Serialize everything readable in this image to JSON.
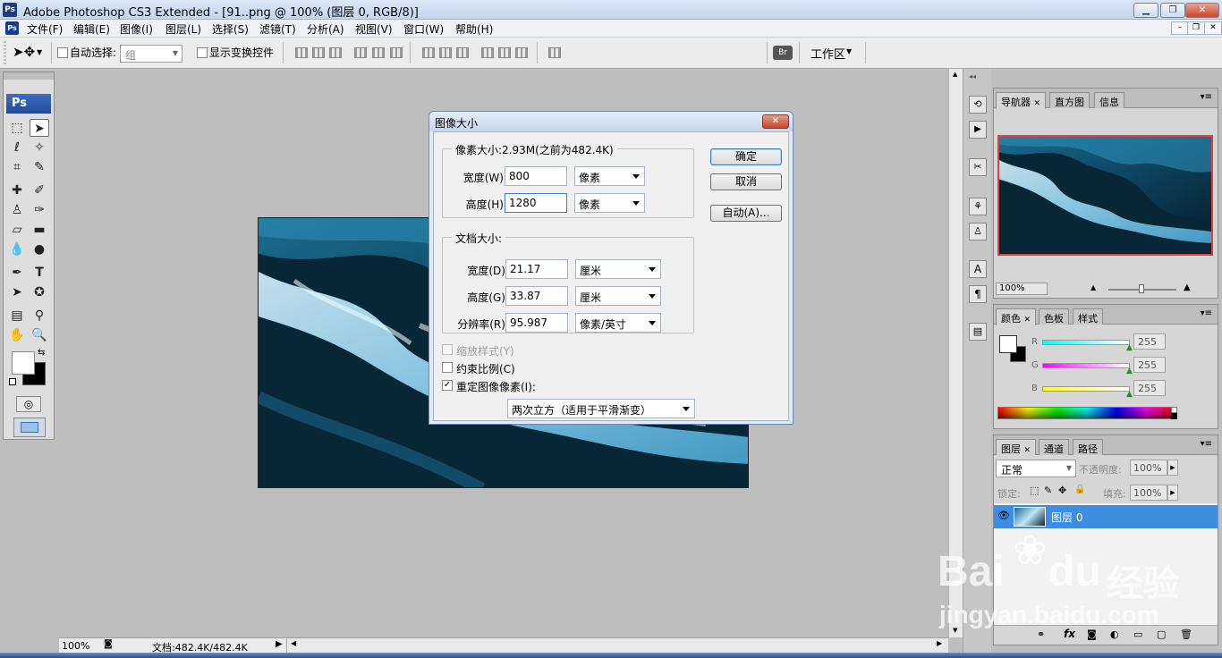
{
  "window": {
    "title": "Adobe Photoshop CS3 Extended - [91..png @ 100% (图层 0, RGB/8)]",
    "app_icon": "Ps",
    "btn_minimize": "▁",
    "btn_restore": "❐",
    "btn_close": "✕"
  },
  "menu": {
    "items": [
      "文件(F)",
      "编辑(E)",
      "图像(I)",
      "图层(L)",
      "选择(S)",
      "滤镜(T)",
      "分析(A)",
      "视图(V)",
      "窗口(W)",
      "帮助(H)"
    ],
    "doc_minimize": "–",
    "doc_restore": "❐",
    "doc_close": "✕"
  },
  "options_bar": {
    "auto_select_label": "自动选择:",
    "auto_select_value": "组",
    "show_transform_label": "显示变换控件",
    "workspace_label": "工作区"
  },
  "toolbox": {
    "logo": "Ps"
  },
  "status_bar": {
    "zoom": "100%",
    "doc_info": "文档:482.4K/482.4K"
  },
  "dialog": {
    "title": "图像大小",
    "pixel_dimensions_label": "像素大小:2.93M(之前为482.4K)",
    "width_label": "宽度(W):",
    "width_value": "800",
    "width_unit": "像素",
    "height_label": "高度(H):",
    "height_value": "1280",
    "height_unit": "像素",
    "document_size_label": "文档大小:",
    "doc_width_label": "宽度(D):",
    "doc_width_value": "21.17",
    "doc_width_unit": "厘米",
    "doc_height_label": "高度(G):",
    "doc_height_value": "33.87",
    "doc_height_unit": "厘米",
    "resolution_label": "分辨率(R):",
    "resolution_value": "95.987",
    "resolution_unit": "像素/英寸",
    "scale_styles_label": "缩放样式(Y)",
    "constrain_label": "约束比例(C)",
    "resample_label": "重定图像像素(I):",
    "resample_method": "两次立方（适用于平滑渐变）",
    "ok_label": "确定",
    "cancel_label": "取消",
    "auto_label": "自动(A)..."
  },
  "navigator_panel": {
    "tabs": [
      "导航器",
      "直方图",
      "信息"
    ],
    "zoom": "100%"
  },
  "color_panel": {
    "tabs": [
      "颜色",
      "色板",
      "样式"
    ],
    "r_label": "R",
    "g_label": "G",
    "b_label": "B",
    "r_value": "255",
    "g_value": "255",
    "b_value": "255"
  },
  "layers_panel": {
    "tabs": [
      "图层",
      "通道",
      "路径"
    ],
    "blend_mode": "正常",
    "opacity_label": "不透明度:",
    "opacity_value": "100%",
    "lock_label": "锁定:",
    "fill_label": "填充:",
    "fill_value": "100%",
    "layer_name": "图层 0"
  },
  "watermark": {
    "text_main": "Bai",
    "text_main2": "du",
    "text_cn": "经验",
    "url": "jingyan.baidu.com"
  },
  "colors": {
    "accent_blue": "#3d8ee0",
    "layer_selected": "#3d8ee0",
    "dialog_frame": "#dfe8f4"
  }
}
